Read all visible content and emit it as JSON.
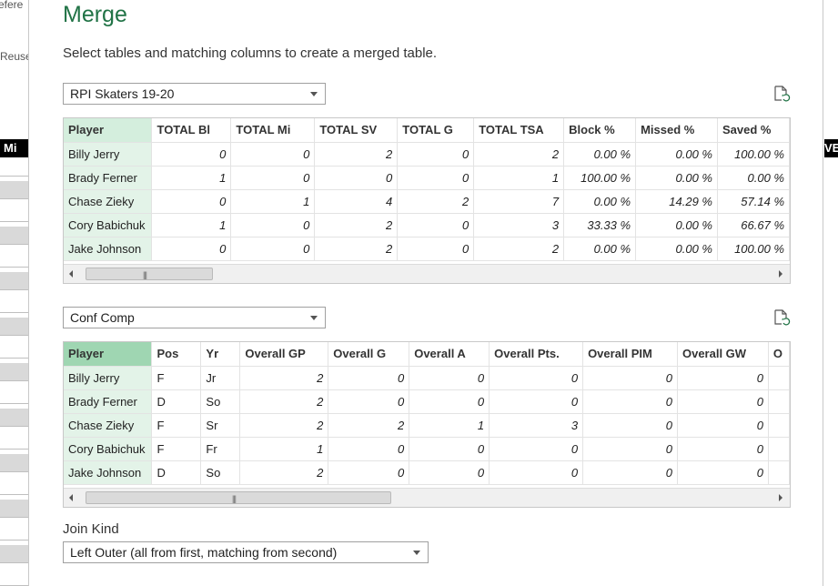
{
  "background": {
    "left_texts": [
      "efere",
      "Reuse"
    ],
    "left_bar": "Mi",
    "right_bar": "VE"
  },
  "dialog": {
    "title": "Merge",
    "subtitle": "Select tables and matching columns to create a merged table.",
    "accent_color": "#217346",
    "key_column_color": "#d4eedd",
    "selected_key_color": "#9fd6b2"
  },
  "table1": {
    "selector_value": "RPI Skaters 19-20",
    "refresh_icon": "refresh-preview-icon",
    "columns": [
      "Player",
      "TOTAL Bl",
      "TOTAL Mi",
      "TOTAL SV",
      "TOTAL G",
      "TOTAL TSA",
      "Block %",
      "Missed %",
      "Saved %"
    ],
    "rows": [
      [
        "Billy Jerry",
        "0",
        "0",
        "2",
        "0",
        "2",
        "0.00 %",
        "0.00 %",
        "100.00 %"
      ],
      [
        "Brady Ferner",
        "1",
        "0",
        "0",
        "0",
        "1",
        "100.00 %",
        "0.00 %",
        "0.00 %"
      ],
      [
        "Chase Zieky",
        "0",
        "1",
        "4",
        "2",
        "7",
        "0.00 %",
        "14.29 %",
        "57.14 %"
      ],
      [
        "Cory Babichuk",
        "1",
        "0",
        "2",
        "0",
        "3",
        "33.33 %",
        "0.00 %",
        "66.67 %"
      ],
      [
        "Jake Johnson",
        "0",
        "0",
        "2",
        "0",
        "2",
        "0.00 %",
        "0.00 %",
        "100.00 %"
      ]
    ]
  },
  "table2": {
    "selector_value": "Conf Comp",
    "refresh_icon": "refresh-preview-icon",
    "columns": [
      "Player",
      "Pos",
      "Yr",
      "Overall GP",
      "Overall G",
      "Overall A",
      "Overall Pts.",
      "Overall PIM",
      "Overall GW",
      "O"
    ],
    "rows": [
      [
        "Billy Jerry",
        "F",
        "Jr",
        "2",
        "0",
        "0",
        "0",
        "0",
        "0"
      ],
      [
        "Brady Ferner",
        "D",
        "So",
        "2",
        "0",
        "0",
        "0",
        "0",
        "0"
      ],
      [
        "Chase Zieky",
        "F",
        "Sr",
        "2",
        "2",
        "1",
        "3",
        "0",
        "0"
      ],
      [
        "Cory Babichuk",
        "F",
        "Fr",
        "1",
        "0",
        "0",
        "0",
        "0",
        "0"
      ],
      [
        "Jake Johnson",
        "D",
        "So",
        "2",
        "0",
        "0",
        "0",
        "0",
        "0"
      ]
    ]
  },
  "join": {
    "label": "Join Kind",
    "value": "Left Outer (all from first, matching from second)"
  }
}
